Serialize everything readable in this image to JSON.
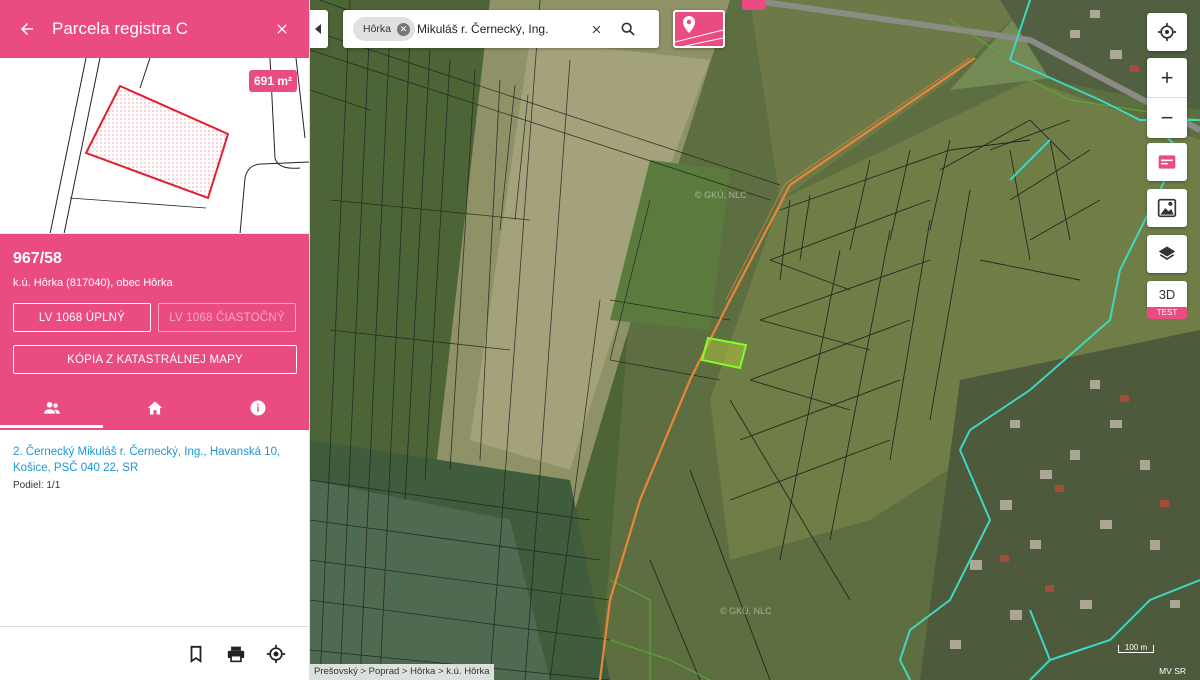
{
  "panel": {
    "title": "Parcela registra C",
    "area_badge": "691 m²",
    "parcel_number": "967/58",
    "location": "k.ú. Hôrka (817040), obec Hôrka",
    "buttons": {
      "lv_full": "LV 1068 ÚPLNÝ",
      "lv_partial": "LV 1068 ČIASTOČNÝ",
      "map_copy": "KÓPIA Z KATASTRÁLNEJ MAPY"
    },
    "tabs": [
      {
        "icon": "people-icon"
      },
      {
        "icon": "home-icon"
      },
      {
        "icon": "info-icon"
      }
    ],
    "owner": {
      "text": "2. Černecký Mikuláš r. Černecký, Ing., Havanská 10, Košice, PSČ 040 22, SR",
      "share": "Podiel: 1/1"
    },
    "footer_icons": [
      "bookmark-icon",
      "print-icon",
      "locate-target-icon"
    ]
  },
  "map": {
    "search": {
      "chip": "Hôrka",
      "text": "Černecký Mikuláš r. Černecký, Ing."
    },
    "controls": {
      "three_d": "3D",
      "test": "TEST"
    },
    "watermark_1": "© GKÚ, NLC",
    "watermark_2": "© GKÚ, NLC",
    "breadcrumb": "Prešovský > Poprad > Hôrka > k.ú. Hôrka",
    "scale": "100 m",
    "attribution": "MV SR"
  },
  "colors": {
    "accent": "#ea4c82",
    "link": "#1a97d6",
    "parcel_highlight": "#7fff2a",
    "road_line": "#e8873a",
    "boundary_line": "#3fd6c2"
  }
}
